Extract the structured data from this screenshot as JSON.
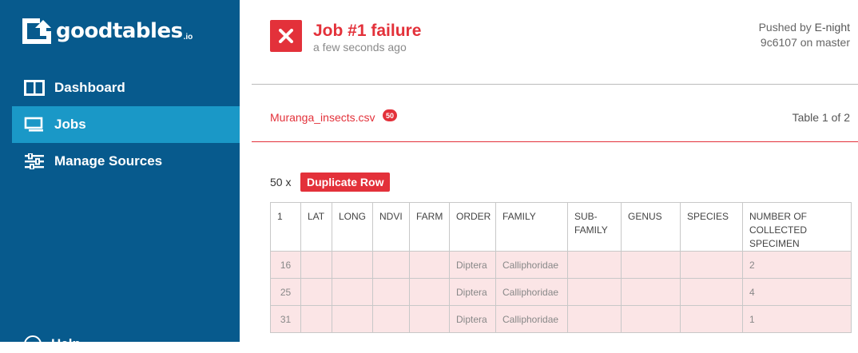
{
  "sidebar": {
    "logo_text": "goodtables",
    "logo_sub": ".io",
    "items": [
      {
        "label": "Dashboard",
        "icon": "columns-icon",
        "active": false
      },
      {
        "label": "Jobs",
        "icon": "monitor-icon",
        "active": true
      },
      {
        "label": "Manage Sources",
        "icon": "sliders-icon",
        "active": false
      }
    ],
    "help_label": "Help"
  },
  "job": {
    "title": "Job #1 failure",
    "time": "a few seconds ago",
    "pushed_prefix": "Pushed by",
    "pushed_user": "E-night",
    "commit_line": "9c6107 on master",
    "status_color": "#e3313a"
  },
  "report": {
    "file_name": "Muranga_insects.csv",
    "error_badge": "50",
    "table_position": "Table 1 of 2",
    "error_count": "50 x",
    "error_type": "Duplicate Row"
  },
  "table": {
    "headers": [
      "1",
      "LAT",
      "LONG",
      "NDVI",
      "FARM",
      "ORDER",
      "FAMILY",
      "SUB-FAMILY",
      "GENUS",
      "SPECIES",
      "NUMBER OF COLLECTED SPECIMEN"
    ],
    "rows": [
      [
        "16",
        "",
        "",
        "",
        "",
        "Diptera",
        "Calliphoridae",
        "",
        "",
        "",
        "2"
      ],
      [
        "25",
        "",
        "",
        "",
        "",
        "Diptera",
        "Calliphoridae",
        "",
        "",
        "",
        "4"
      ],
      [
        "31",
        "",
        "",
        "",
        "",
        "Diptera",
        "Calliphoridae",
        "",
        "",
        "",
        "1"
      ]
    ]
  }
}
